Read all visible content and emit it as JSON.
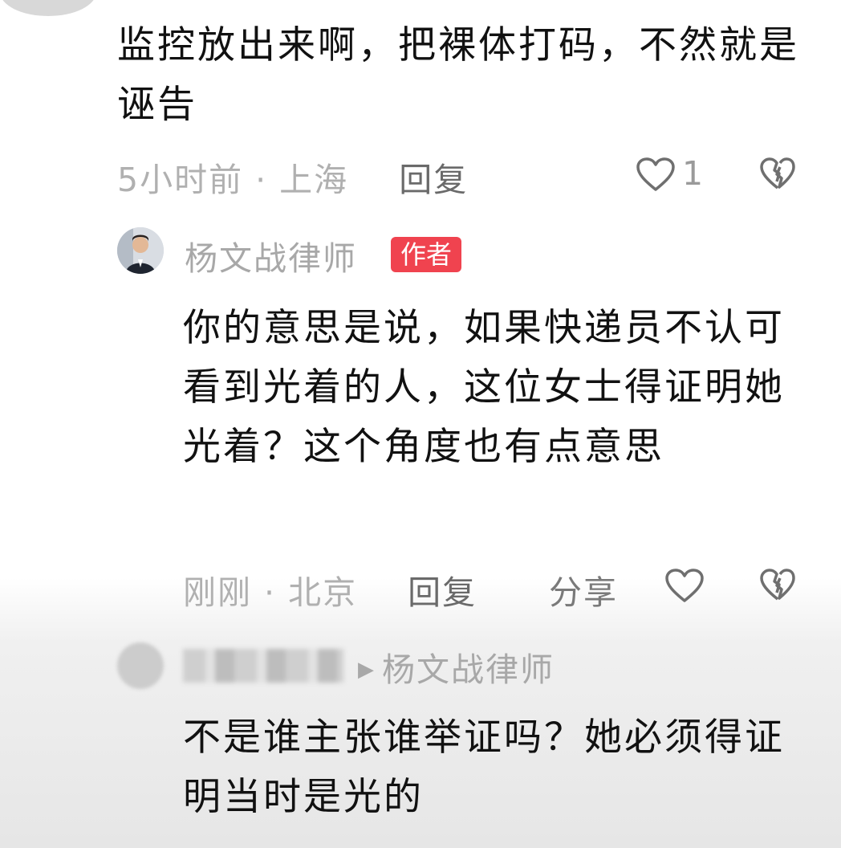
{
  "comment": {
    "text": "监控放出来啊，把裸体打码，不然就是诬告",
    "time_location": "5小时前 · 上海",
    "reply_label": "回复",
    "like_count": "1"
  },
  "reply1": {
    "author": "杨文战律师",
    "badge": "作者",
    "text": "你的意思是说，如果快递员不认可看到光着的人，这位女士得证明她光着？这个角度也有点意思",
    "time_location": "刚刚 · 北京",
    "reply_label": "回复",
    "share_label": "分享"
  },
  "reply2": {
    "reply_to": "杨文战律师",
    "text": "不是谁主张谁举证吗？她必须得证明当时是光的"
  },
  "icons": {
    "like": "heart-outline-icon",
    "dislike": "broken-heart-icon"
  },
  "colors": {
    "badge": "#f0434f",
    "meta_text": "#b0b0b0"
  }
}
